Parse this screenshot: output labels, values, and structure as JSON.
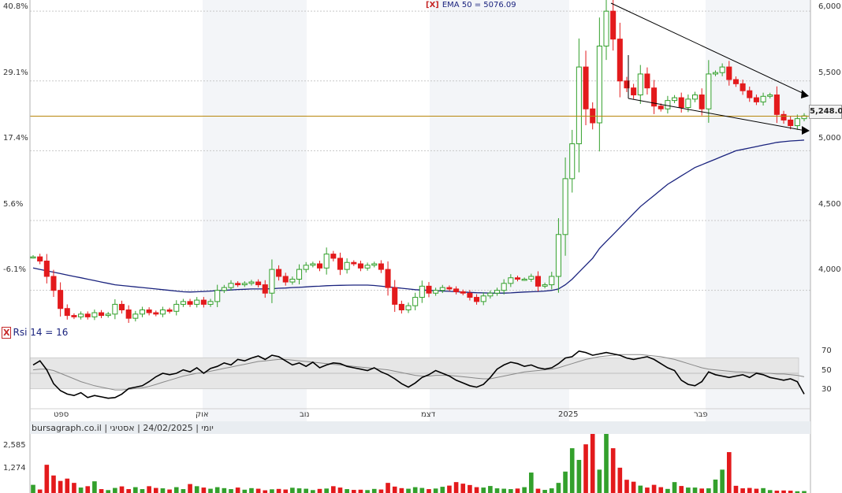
{
  "header": {
    "ema_prefix": "[X]",
    "ema_label": "EMA 50 = 5076.09"
  },
  "rsi_panel": {
    "prefix": "X",
    "label": "Rsi 14 = 16",
    "ticks": [
      "70",
      "50",
      "30"
    ]
  },
  "price_axis": {
    "right_ticks": [
      "6,000",
      "5,500",
      "5,000",
      "4,500",
      "4,000"
    ],
    "left_ticks": [
      "40.8%",
      "29.1%",
      "17.4%",
      "5.6%",
      "-6.1%"
    ],
    "last_price_label": "5,248.00"
  },
  "time_axis": {
    "labels": [
      "ספט",
      "אוק",
      "נוב",
      "דצמ",
      "2025",
      "פבר"
    ]
  },
  "info_bar": {
    "text": "יומי | 24/02/2025 | אסטיגי | bursagraph.co.il"
  },
  "volume_axis": {
    "ticks": [
      "2,585",
      "1,274"
    ]
  },
  "colors": {
    "up": "#33a02c",
    "down": "#e31a1c",
    "ema": "#1a237e",
    "last_price_line": "#b8860b",
    "rsi": "#000000",
    "rsi_signal": "#888888"
  },
  "chart_data": [
    {
      "type": "candlestick",
      "ylim": [
        3750,
        6080
      ],
      "series": [
        {
          "name": "price",
          "close": [
            4240,
            4210,
            4100,
            4000,
            3870,
            3820,
            3810,
            3830,
            3810,
            3840,
            3820,
            3830,
            3900,
            3860,
            3800,
            3830,
            3860,
            3840,
            3830,
            3860,
            3850,
            3900,
            3920,
            3900,
            3930,
            3900,
            3920,
            4000,
            4020,
            4050,
            4040,
            4050,
            4060,
            4040,
            3980,
            4150,
            4100,
            4060,
            4080,
            4150,
            4180,
            4190,
            4160,
            4260,
            4230,
            4150,
            4200,
            4190,
            4160,
            4180,
            4190,
            4150,
            4020,
            3900,
            3860,
            3890,
            3950,
            4030,
            3980,
            4000,
            4020,
            4010,
            3990,
            3980,
            3950,
            3920,
            3960,
            3980,
            4000,
            4050,
            4090,
            4080,
            4080,
            4100,
            4030,
            4040,
            4100,
            4400,
            4800,
            5050,
            5600,
            5300,
            5200,
            5750,
            6000,
            5800,
            5500,
            5450,
            5400,
            5550,
            5450,
            5320,
            5300,
            5360,
            5380,
            5310,
            5370,
            5400,
            5300,
            5550,
            5560,
            5600,
            5510,
            5480,
            5430,
            5380,
            5350,
            5390,
            5400,
            5260,
            5220,
            5180,
            5230,
            5250
          ]
        },
        {
          "name": "EMA 50",
          "values": [
            4160,
            4150,
            4140,
            4130,
            4120,
            4110,
            4100,
            4090,
            4080,
            4070,
            4060,
            4050,
            4040,
            4035,
            4030,
            4025,
            4020,
            4015,
            4010,
            4005,
            4000,
            3995,
            3990,
            3988,
            3990,
            3992,
            3995,
            3998,
            4000,
            4003,
            4006,
            4008,
            4010,
            4010,
            4010,
            4012,
            4015,
            4017,
            4020,
            4022,
            4025,
            4028,
            4030,
            4033,
            4035,
            4036,
            4037,
            4038,
            4038,
            4038,
            4035,
            4030,
            4025,
            4020,
            4015,
            4010,
            4005,
            4002,
            4000,
            3998,
            3995,
            3993,
            3990,
            3988,
            3985,
            3983,
            3982,
            3980,
            3980,
            3980,
            3982,
            3985,
            3988,
            3990,
            3992,
            3995,
            4000,
            4010,
            4040,
            4080,
            4130,
            4180,
            4230,
            4300,
            4350,
            4400,
            4450,
            4500,
            4550,
            4600,
            4640,
            4680,
            4720,
            4760,
            4790,
            4820,
            4850,
            4880,
            4900,
            4920,
            4940,
            4960,
            4980,
            5000,
            5010,
            5020,
            5030,
            5040,
            5050,
            5060,
            5065,
            5070,
            5073,
            5076.09
          ]
        }
      ]
    },
    {
      "type": "line",
      "ylim": [
        0,
        100
      ],
      "series": [
        {
          "name": "Rsi 14",
          "values": [
            62,
            68,
            55,
            35,
            25,
            20,
            18,
            22,
            15,
            18,
            16,
            14,
            15,
            20,
            28,
            30,
            32,
            38,
            45,
            50,
            48,
            50,
            55,
            52,
            58,
            50,
            57,
            60,
            65,
            62,
            70,
            68,
            72,
            75,
            70,
            76,
            74,
            68,
            62,
            65,
            60,
            66,
            58,
            62,
            65,
            64,
            60,
            58,
            56,
            54,
            58,
            52,
            48,
            42,
            35,
            30,
            36,
            44,
            48,
            54,
            50,
            46,
            40,
            36,
            32,
            30,
            34,
            44,
            56,
            62,
            66,
            64,
            60,
            62,
            58,
            56,
            58,
            64,
            72,
            74,
            82,
            80,
            76,
            78,
            80,
            78,
            76,
            72,
            70,
            72,
            74,
            70,
            64,
            58,
            54,
            40,
            34,
            32,
            38,
            52,
            48,
            46,
            44,
            46,
            48,
            44,
            50,
            48,
            44,
            42,
            40,
            42,
            38,
            20
          ]
        },
        {
          "name": "signal",
          "values": [
            55,
            56,
            56,
            54,
            50,
            46,
            42,
            38,
            35,
            32,
            30,
            28,
            26,
            26,
            27,
            28,
            29,
            31,
            34,
            37,
            40,
            43,
            46,
            48,
            50,
            51,
            53,
            55,
            57,
            59,
            61,
            63,
            65,
            67,
            68,
            69,
            70,
            70,
            69,
            68,
            67,
            66,
            65,
            64,
            63,
            62,
            61,
            60,
            59,
            58,
            57,
            56,
            55,
            53,
            51,
            49,
            47,
            46,
            46,
            47,
            47,
            47,
            46,
            45,
            44,
            43,
            42,
            42,
            44,
            46,
            48,
            50,
            52,
            53,
            54,
            55,
            56,
            58,
            61,
            64,
            67,
            70,
            72,
            74,
            75,
            76,
            77,
            77,
            77,
            77,
            76,
            75,
            74,
            72,
            70,
            67,
            64,
            61,
            58,
            56,
            55,
            54,
            53,
            52,
            52,
            51,
            51,
            50,
            50,
            49,
            49,
            48,
            47,
            45
          ]
        }
      ]
    },
    {
      "type": "bar",
      "ylim": [
        0,
        3600
      ],
      "series": [
        {
          "name": "volume",
          "values": [
            420,
            180,
            1450,
            900,
            620,
            740,
            520,
            280,
            350,
            600,
            200,
            150,
            260,
            340,
            200,
            300,
            200,
            350,
            260,
            240,
            180,
            300,
            200,
            460,
            350,
            280,
            220,
            300,
            250,
            200,
            280,
            170,
            250,
            220,
            140,
            190,
            210,
            180,
            270,
            240,
            220,
            150,
            210,
            230,
            350,
            280,
            200,
            160,
            170,
            150,
            210,
            180,
            520,
            330,
            250,
            220,
            300,
            260,
            200,
            230,
            320,
            380,
            560,
            480,
            410,
            300,
            280,
            360,
            240,
            220,
            200,
            230,
            300,
            1050,
            220,
            160,
            240,
            520,
            1100,
            2300,
            1700,
            2500,
            3600,
            1200,
            3600,
            2300,
            1300,
            680,
            580,
            380,
            280,
            420,
            300,
            210,
            560,
            360,
            280,
            280,
            230,
            240,
            690,
            1200,
            2100,
            370,
            240,
            260,
            220,
            250,
            150,
            120,
            130,
            120,
            90,
            100
          ]
        }
      ]
    }
  ]
}
